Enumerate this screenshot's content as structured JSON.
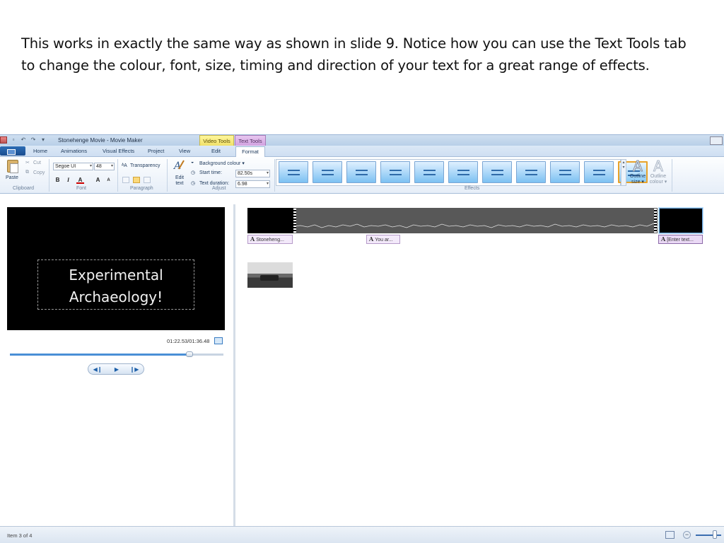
{
  "slide": {
    "caption": "This works in exactly the same way as shown in slide 9. Notice how you can use the Text Tools tab to change the colour, font, size, timing and direction of your text for a great range of effects."
  },
  "window": {
    "title": "Stonehenge Movie - Movie Maker",
    "context_tabs": [
      "Video Tools",
      "Text Tools"
    ]
  },
  "tabs": {
    "home": "Home",
    "animations": "Animations",
    "visual_effects": "Visual Effects",
    "project": "Project",
    "view": "View",
    "edit": "Edit",
    "format": "Format"
  },
  "ribbon": {
    "clipboard": {
      "paste": "Paste",
      "cut": "Cut",
      "copy": "Copy",
      "label": "Clipboard"
    },
    "font": {
      "family": "Segoe UI",
      "size": "48",
      "label": "Font",
      "bold": "B",
      "italic": "I",
      "color": "A",
      "grow": "A",
      "shrink": "A"
    },
    "paragraph": {
      "transparency": "Transparency",
      "label": "Paragraph"
    },
    "adjust": {
      "edit_text": "Edit text",
      "background_colour": "Background colour ▾",
      "start_time_label": "Start time:",
      "start_time_value": "82.50s",
      "text_duration_label": "Text duration:",
      "text_duration_value": "6.98",
      "label": "Adjust"
    },
    "effects": {
      "label": "Effects",
      "count": 11,
      "selected_index": 10
    },
    "outline_size": "Outline size ▾",
    "outline_colour": "Outline colour ▾"
  },
  "preview": {
    "line1": "Experimental",
    "line2": "Archaeology!",
    "time": "01:22.53/01:36.48",
    "seek_progress": 0.84
  },
  "storyboard": {
    "captions": [
      {
        "label": "Stoneheng..."
      },
      {
        "label": "You ar..."
      },
      {
        "label": "[Enter text..."
      }
    ]
  },
  "status": {
    "item_text": "Item 3 of 4",
    "zoom_out": "−"
  }
}
